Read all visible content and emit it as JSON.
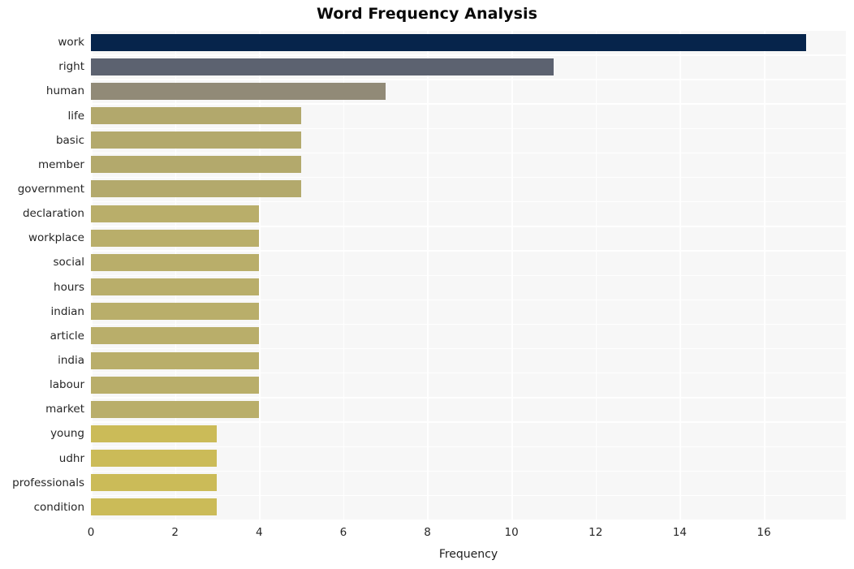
{
  "chart_data": {
    "type": "bar",
    "orientation": "horizontal",
    "title": "Word Frequency Analysis",
    "xlabel": "Frequency",
    "ylabel": "",
    "categories": [
      "work",
      "right",
      "human",
      "life",
      "basic",
      "member",
      "government",
      "declaration",
      "workplace",
      "social",
      "hours",
      "indian",
      "article",
      "india",
      "labour",
      "market",
      "young",
      "udhr",
      "professionals",
      "condition"
    ],
    "values": [
      17,
      11,
      7,
      5,
      5,
      5,
      5,
      4,
      4,
      4,
      4,
      4,
      4,
      4,
      4,
      4,
      3,
      3,
      3,
      3
    ],
    "bar_colors": [
      "#06244b",
      "#5c6270",
      "#918a77",
      "#b2a86c",
      "#b3a96c",
      "#b3a96c",
      "#b3a96c",
      "#b9ae6a",
      "#b9ae6a",
      "#b9ae6a",
      "#b9ae6a",
      "#b9ae6a",
      "#b9ae6a",
      "#b9ae6a",
      "#b9ae6a",
      "#b9ae6a",
      "#cbbb58",
      "#cbbb58",
      "#cbbb58",
      "#cbbb58"
    ],
    "xticks": [
      0,
      2,
      4,
      6,
      8,
      10,
      12,
      14,
      16
    ],
    "xticklabels": [
      "0",
      "2",
      "4",
      "6",
      "8",
      "10",
      "12",
      "14",
      "16"
    ],
    "xlim": [
      0,
      17.95
    ],
    "grid": true,
    "grid_color": "#ffffff",
    "plot_background": "#f7f7f7",
    "page_background": "#ffffff",
    "legend": null
  }
}
